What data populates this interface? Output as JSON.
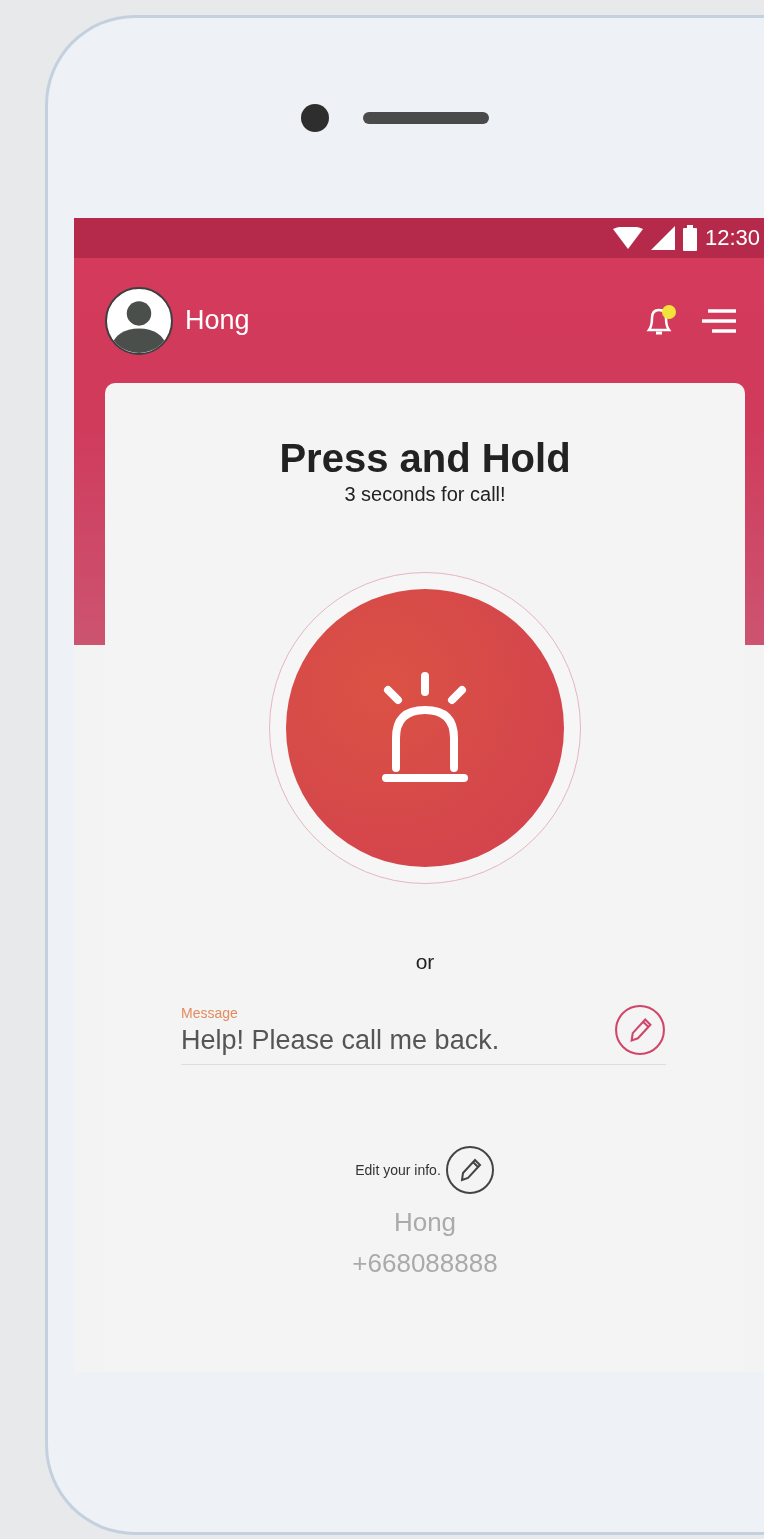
{
  "status_bar": {
    "time": "12:30"
  },
  "toolbar": {
    "user_name": "Hong",
    "notifications_unread": true
  },
  "card": {
    "title": "Press and Hold",
    "subtitle": "3 seconds for call!",
    "separator": "or",
    "message_field": {
      "label": "Message",
      "value": "Help! Please call me back."
    },
    "edit_info_label": "Edit your info.",
    "contact": {
      "name": "Hong",
      "phone": "+668088888"
    }
  }
}
